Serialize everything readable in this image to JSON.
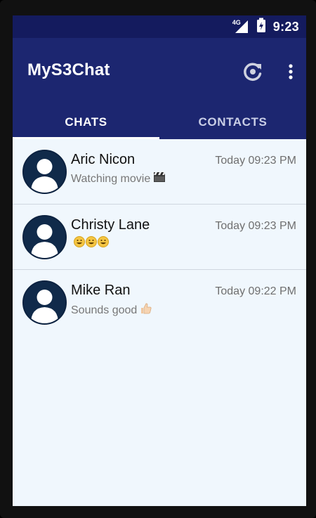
{
  "status_bar": {
    "network": "4G",
    "time": "9:23"
  },
  "app_bar": {
    "title": "MyS3Chat",
    "refresh_icon": "refresh-icon",
    "menu_icon": "more-vert-icon"
  },
  "tabs": [
    {
      "label": "CHATS",
      "active": true
    },
    {
      "label": "CONTACTS",
      "active": false
    }
  ],
  "chats": [
    {
      "name": "Aric Nicon",
      "time": "Today 09:23 PM",
      "message": "Watching movie",
      "emoji": "clapperboard-icon"
    },
    {
      "name": "Christy Lane",
      "time": "Today 09:23 PM",
      "message": "",
      "emoji": "smiley-x3-icon"
    },
    {
      "name": "Mike Ran",
      "time": "Today 09:22 PM",
      "message": "Sounds good",
      "emoji": "thumbs-up-icon"
    }
  ],
  "colors": {
    "status_bar": "#141b5e",
    "app_bar": "#1c2670",
    "list_background": "#f0f7fd",
    "avatar": "#102a4a"
  }
}
